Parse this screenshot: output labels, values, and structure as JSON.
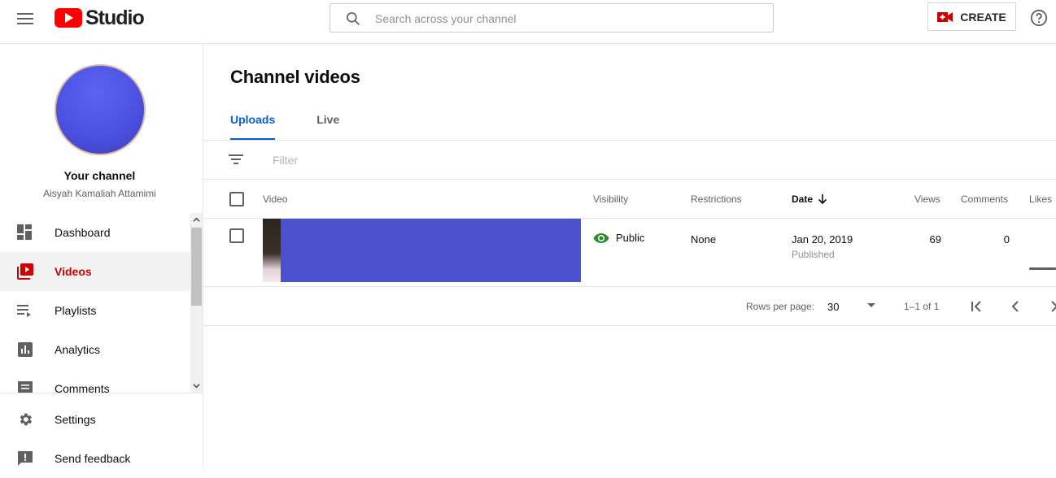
{
  "header": {
    "logo_text": "Studio",
    "search_placeholder": "Search across your channel",
    "create_label": "CREATE",
    "colors": {
      "brand_red": "#ff0000",
      "accent_blue": "#065fd4"
    }
  },
  "sidebar": {
    "channel_title": "Your channel",
    "channel_name": "Aisyah Kamaliah Attamimi",
    "items": [
      {
        "label": "Dashboard",
        "icon": "dashboard-icon"
      },
      {
        "label": "Videos",
        "icon": "videos-icon",
        "active": true
      },
      {
        "label": "Playlists",
        "icon": "playlists-icon"
      },
      {
        "label": "Analytics",
        "icon": "analytics-icon"
      },
      {
        "label": "Comments",
        "icon": "comments-icon"
      }
    ],
    "bottom_items": [
      {
        "label": "Settings",
        "icon": "gear-icon"
      },
      {
        "label": "Send feedback",
        "icon": "feedback-icon"
      }
    ]
  },
  "main": {
    "title": "Channel videos",
    "tabs": [
      {
        "label": "Uploads",
        "active": true
      },
      {
        "label": "Live"
      }
    ],
    "filter_placeholder": "Filter",
    "columns": {
      "video": "Video",
      "visibility": "Visibility",
      "restrictions": "Restrictions",
      "date": "Date",
      "views": "Views",
      "comments": "Comments",
      "likes": "Likes"
    },
    "rows": [
      {
        "visibility": "Public",
        "restrictions": "None",
        "date": "Jan 20, 2019",
        "status": "Published",
        "views": "69",
        "comments": "0"
      }
    ],
    "pagination": {
      "rows_per_page_label": "Rows per page:",
      "rows_per_page": "30",
      "range": "1–1 of 1"
    }
  }
}
